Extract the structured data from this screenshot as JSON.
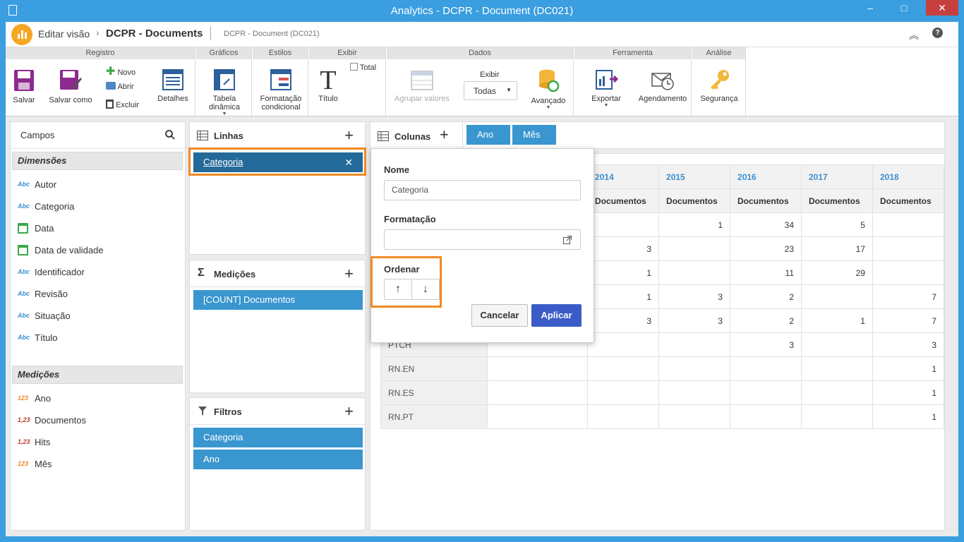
{
  "window": {
    "title": "Analytics - DCPR - Document (DC021)",
    "min": "–",
    "max": "□",
    "close": "✕"
  },
  "header": {
    "edit_view": "Editar visão",
    "separator": "›",
    "doc_title": "DCPR - Documents",
    "doc_sub": "DCPR - Document (DC021)",
    "collapse": "︽",
    "help": "?"
  },
  "ribbon": {
    "groups": {
      "registro": "Registro",
      "graficos": "Gráficos",
      "estilos": "Estilos",
      "exibir": "Exibir",
      "dados": "Dados",
      "ferramenta": "Ferramenta",
      "analise": "Análise"
    },
    "salvar": "Salvar",
    "salvar_como": "Salvar como",
    "novo": "Novo",
    "abrir": "Abrir",
    "excluir": "Excluir",
    "detalhes": "Detalhes",
    "tabela_1": "Tabela",
    "tabela_2": "dinâmica",
    "formatacao_1": "Formatação",
    "formatacao_2": "condicional",
    "titulo": "Título",
    "total": "Total",
    "agrupar": "Agrupar valores",
    "exibir_label": "Exibir",
    "exibir_value": "Todas",
    "avancado": "Avançado",
    "exportar": "Exportar",
    "agendamento": "Agendamento",
    "seguranca": "Segurança"
  },
  "campos": {
    "title": "Campos",
    "dimensoes": "Dimensões",
    "dims": [
      {
        "tag": "Abc",
        "label": "Autor"
      },
      {
        "tag": "Abc",
        "label": "Categoria"
      },
      {
        "tag": "cal",
        "label": "Data"
      },
      {
        "tag": "cal",
        "label": "Data de validade"
      },
      {
        "tag": "Abc",
        "label": "Identificador"
      },
      {
        "tag": "Abc",
        "label": "Revisão"
      },
      {
        "tag": "Abc",
        "label": "Situação"
      },
      {
        "tag": "Abc",
        "label": "Título"
      }
    ],
    "medicoes": "Medições",
    "meas": [
      {
        "tag": "123",
        "label": "Ano"
      },
      {
        "tag": "1,23",
        "label": "Documentos"
      },
      {
        "tag": "1,23",
        "label": "Hits"
      },
      {
        "tag": "123",
        "label": "Mês"
      }
    ]
  },
  "linhas": {
    "title": "Linhas",
    "chip": "Categoria",
    "remove": "✕"
  },
  "medicoes_panel": {
    "title": "Medições",
    "chip": "[COUNT] Documentos"
  },
  "filtros": {
    "title": "Filtros",
    "chips": [
      "Categoria",
      "Ano"
    ]
  },
  "colunas": {
    "title": "Colunas",
    "chips": [
      "Ano",
      "Mês"
    ]
  },
  "pivot": {
    "years": [
      "2014",
      "2015",
      "2016",
      "2017",
      "2018"
    ],
    "measure": "Documentos",
    "rows": [
      {
        "label": "",
        "vals": [
          "",
          "1",
          "34",
          "5",
          ""
        ]
      },
      {
        "label": "",
        "vals": [
          "3",
          "",
          "23",
          "17",
          ""
        ]
      },
      {
        "label": "",
        "vals": [
          "1",
          "",
          "11",
          "29",
          ""
        ]
      },
      {
        "label": "",
        "vals": [
          "1",
          "3",
          "2",
          "",
          "7"
        ]
      },
      {
        "label": "",
        "vals": [
          "3",
          "3",
          "2",
          "1",
          "7"
        ]
      },
      {
        "label": "PTCH",
        "vals": [
          "",
          "",
          "3",
          "",
          "3"
        ]
      },
      {
        "label": "RN.EN",
        "vals": [
          "",
          "",
          "",
          "",
          "1"
        ]
      },
      {
        "label": "RN.ES",
        "vals": [
          "",
          "",
          "",
          "",
          "1"
        ]
      },
      {
        "label": "RN.PT",
        "vals": [
          "",
          "",
          "",
          "",
          "1"
        ]
      }
    ]
  },
  "dialog": {
    "nome_label": "Nome",
    "nome_value": "Categoria",
    "formatacao_label": "Formatação",
    "ordenar_label": "Ordenar",
    "up": "↑",
    "down": "↓",
    "cancelar": "Cancelar",
    "aplicar": "Aplicar"
  },
  "colors": {
    "accent": "#3a96cf",
    "highlight": "#f08a24",
    "selected_chip": "#236a9a",
    "aplicar": "#3b5cc6"
  }
}
